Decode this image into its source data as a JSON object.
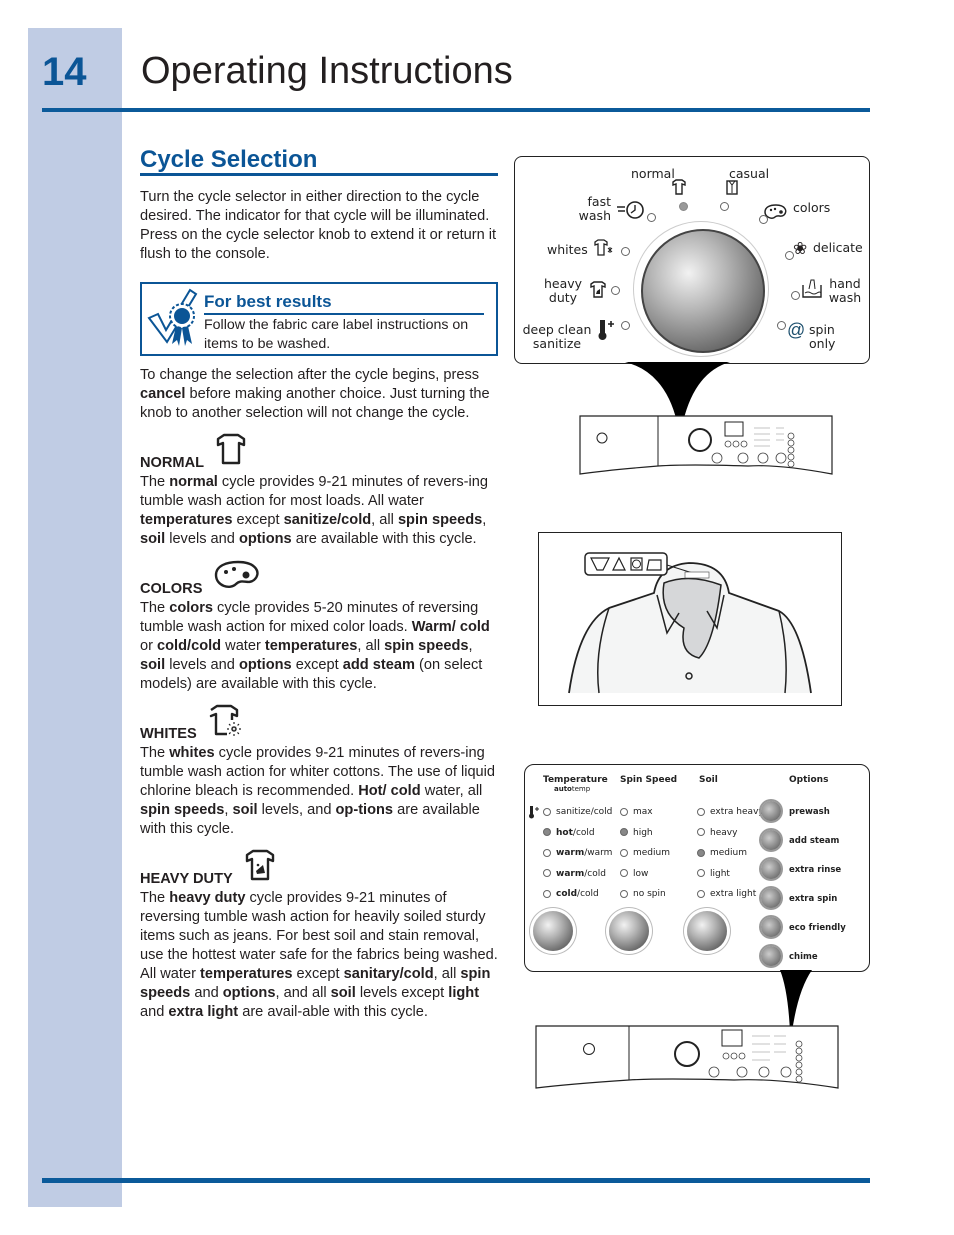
{
  "header": {
    "page_number": "14",
    "title": "Operating Instructions"
  },
  "section": {
    "title": "Cycle Selection",
    "intro": "Turn the cycle selector in either direction to the cycle desired. The indicator for that cycle will be illuminated. Press on the cycle selector knob to extend it or return it flush to the console.",
    "tip": {
      "icon": "checkmark-ribbon-icon",
      "title": "For best results",
      "text": "Follow the fabric care label instructions on items to be washed."
    },
    "change_note": {
      "before": "To change the selection after the cycle begins, press ",
      "bold": "cancel",
      "after": " before making another choice. Just turning the knob to another selection will not change the cycle."
    }
  },
  "cycles": [
    {
      "name": "NORMAL",
      "icon": "shirt-icon",
      "segments": [
        {
          "t": "The "
        },
        {
          "b": "normal"
        },
        {
          "t": " cycle provides 9-21 minutes of revers-ing tumble wash action for most loads. All water "
        },
        {
          "b": "temperatures"
        },
        {
          "t": " except "
        },
        {
          "b": "sanitize/cold"
        },
        {
          "t": ", all "
        },
        {
          "b": "spin speeds"
        },
        {
          "t": ", "
        },
        {
          "b": "soil"
        },
        {
          "t": " levels and "
        },
        {
          "b": "options"
        },
        {
          "t": " are available with this cycle."
        }
      ]
    },
    {
      "name": "COLORS",
      "icon": "palette-icon",
      "segments": [
        {
          "t": "The "
        },
        {
          "b": "colors"
        },
        {
          "t": " cycle provides 5-20 minutes of reversing tumble wash action for mixed color loads. "
        },
        {
          "b": "Warm/ cold"
        },
        {
          "t": " or "
        },
        {
          "b": "cold/cold"
        },
        {
          "t": " water "
        },
        {
          "b": "temperatures"
        },
        {
          "t": ", all "
        },
        {
          "b": "spin speeds"
        },
        {
          "t": ", "
        },
        {
          "b": "soil"
        },
        {
          "t": " levels and "
        },
        {
          "b": "options"
        },
        {
          "t": " except "
        },
        {
          "b": "add steam"
        },
        {
          "t": " (on select models) are available with this cycle."
        }
      ]
    },
    {
      "name": "WHITES",
      "icon": "shirt-sparkle-icon",
      "segments": [
        {
          "t": "The "
        },
        {
          "b": "whites"
        },
        {
          "t": " cycle provides 9-21 minutes of revers-ing tumble wash action for whiter cottons. The use of liquid chlorine bleach is recommended. "
        },
        {
          "b": "Hot/ cold"
        },
        {
          "t": " water, all "
        },
        {
          "b": "spin speeds"
        },
        {
          "t": ", "
        },
        {
          "b": "soil"
        },
        {
          "t": " levels, and "
        },
        {
          "b": "op-tions"
        },
        {
          "t": " are available with this cycle."
        }
      ]
    },
    {
      "name": "HEAVY DUTY",
      "icon": "shirt-stain-icon",
      "segments": [
        {
          "t": "The "
        },
        {
          "b": "heavy duty"
        },
        {
          "t": " cycle provides 9-21 minutes of reversing tumble wash action for heavily soiled sturdy items such as jeans. For best soil and stain removal, use the hottest water safe for the fabrics being washed. All water "
        },
        {
          "b": "temperatures"
        },
        {
          "t": " except "
        },
        {
          "b": "sanitary/cold"
        },
        {
          "t": ", all "
        },
        {
          "b": "spin speeds"
        },
        {
          "t": " and "
        },
        {
          "b": "options"
        },
        {
          "t": ", and all "
        },
        {
          "b": "soil"
        },
        {
          "t": " levels except "
        },
        {
          "b": "light"
        },
        {
          "t": " and "
        },
        {
          "b": "extra light"
        },
        {
          "t": " are avail-able with this cycle."
        }
      ]
    }
  ],
  "cycle_dial": {
    "selected": "normal",
    "labels": {
      "normal": "normal",
      "casual": "casual",
      "fast_wash": "fast wash",
      "colors": "colors",
      "whites": "whites",
      "delicate": "delicate",
      "heavy_duty": "heavy duty",
      "hand_wash": "hand wash",
      "deep_clean": "deep clean sanitize",
      "spin_only": "spin only"
    }
  },
  "options_panel": {
    "headers": {
      "temperature": "Temperature",
      "autotemp_bold": "auto",
      "autotemp_rest": "temp",
      "spin": "Spin Speed",
      "soil": "Soil",
      "options": "Options"
    },
    "temperature": [
      {
        "bold": "",
        "rest": "sanitize/cold",
        "selected": false
      },
      {
        "bold": "hot",
        "rest": "/cold",
        "selected": true
      },
      {
        "bold": "warm",
        "rest": "/warm",
        "selected": false
      },
      {
        "bold": "warm",
        "rest": "/cold",
        "selected": false
      },
      {
        "bold": "cold",
        "rest": "/cold",
        "selected": false
      }
    ],
    "spin": [
      {
        "label": "max",
        "selected": false
      },
      {
        "label": "high",
        "selected": true
      },
      {
        "label": "medium",
        "selected": false
      },
      {
        "label": "low",
        "selected": false
      },
      {
        "label": "no spin",
        "selected": false
      }
    ],
    "soil": [
      {
        "label": "extra heavy",
        "selected": false
      },
      {
        "label": "heavy",
        "selected": false
      },
      {
        "label": "medium",
        "selected": true
      },
      {
        "label": "light",
        "selected": false
      },
      {
        "label": "extra light",
        "selected": false
      }
    ],
    "options": [
      "prewash",
      "add steam",
      "extra rinse",
      "extra spin",
      "eco friendly",
      "chime"
    ]
  },
  "colors": {
    "accent": "#0b5596",
    "sidebar": "#c0cce4",
    "text": "#231f20"
  }
}
